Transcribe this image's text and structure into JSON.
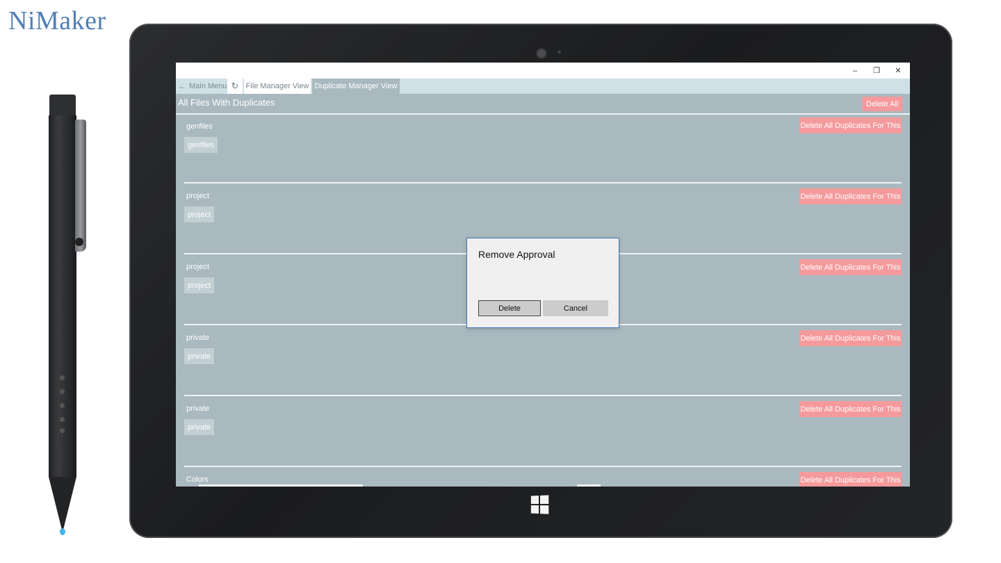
{
  "logo": {
    "text": "NiMaker"
  },
  "window": {
    "minimize_icon": "–",
    "restore_icon": "❐",
    "close_icon": "✕"
  },
  "nav": {
    "back_icon": "←",
    "back_label": "Main Menu",
    "refresh_icon": "↻",
    "tab_file_manager": "File Manager View",
    "tab_duplicate_manager": "Duplicate Manager View",
    "active_tab": "Duplicate Manager View"
  },
  "page": {
    "title": "All Files With Duplicates",
    "delete_all_label": "Delete All"
  },
  "groups": [
    {
      "title": "genfiles",
      "chip": "genfiles",
      "button": "Delete All Duplicates For This"
    },
    {
      "title": "project",
      "chip": "project",
      "button": "Delete All Duplicates For This"
    },
    {
      "title": "project",
      "chip": "project",
      "button": "Delete All Duplicates For This"
    },
    {
      "title": "private",
      "chip": "private",
      "button": "Delete All Duplicates For This"
    },
    {
      "title": "private",
      "chip": "private",
      "button": "Delete All Duplicates For This"
    },
    {
      "title": "Colors",
      "chip": "",
      "button": "Delete All Duplicates For This"
    }
  ],
  "dialog": {
    "title": "Remove Approval",
    "delete_label": "Delete",
    "cancel_label": "Cancel"
  },
  "colors": {
    "screen_bg": "#a9b9bf",
    "nav_bg": "#cfe0e6",
    "danger": "#f59a9c",
    "chip_bg": "#c2cfd3",
    "dialog_border": "#3e74b4",
    "logo": "#4f7fb4"
  }
}
